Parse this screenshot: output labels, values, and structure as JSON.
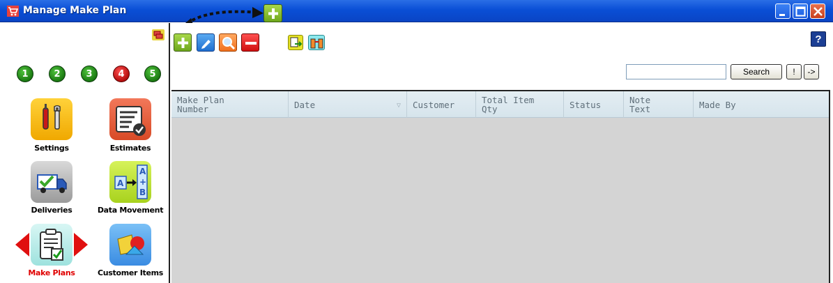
{
  "window": {
    "title": "Manage Make Plan"
  },
  "sidebar": {
    "steps": [
      "1",
      "2",
      "3",
      "4",
      "5"
    ],
    "apps": [
      {
        "label": "Settings",
        "icon": "wrench-screwdriver-icon"
      },
      {
        "label": "Estimates",
        "icon": "document-check-icon"
      },
      {
        "label": "Deliveries",
        "icon": "delivery-truck-icon"
      },
      {
        "label": "Data Movement",
        "icon": "data-transfer-icon"
      },
      {
        "label": "Make Plans",
        "icon": "clipboard-check-icon",
        "active": true
      },
      {
        "label": "Customer Items",
        "icon": "shapes-icon"
      }
    ]
  },
  "toolbar": {
    "help_label": "?",
    "search": {
      "value": "",
      "button_label": "Search"
    },
    "excl_label": "!",
    "go_label": "->"
  },
  "grid": {
    "columns": [
      {
        "label": "Make Plan Number"
      },
      {
        "label": "Date",
        "sortable": true
      },
      {
        "label": "Customer"
      },
      {
        "label": "Total Item Qty"
      },
      {
        "label": "Status"
      },
      {
        "label": "Note Text"
      },
      {
        "label": "Made By"
      }
    ],
    "rows": []
  },
  "colors": {
    "titlebar": "#0a4fd6",
    "active_label": "#e00000",
    "grid_bg": "#d4d4d4",
    "header_bg": "#dbe8ef"
  }
}
